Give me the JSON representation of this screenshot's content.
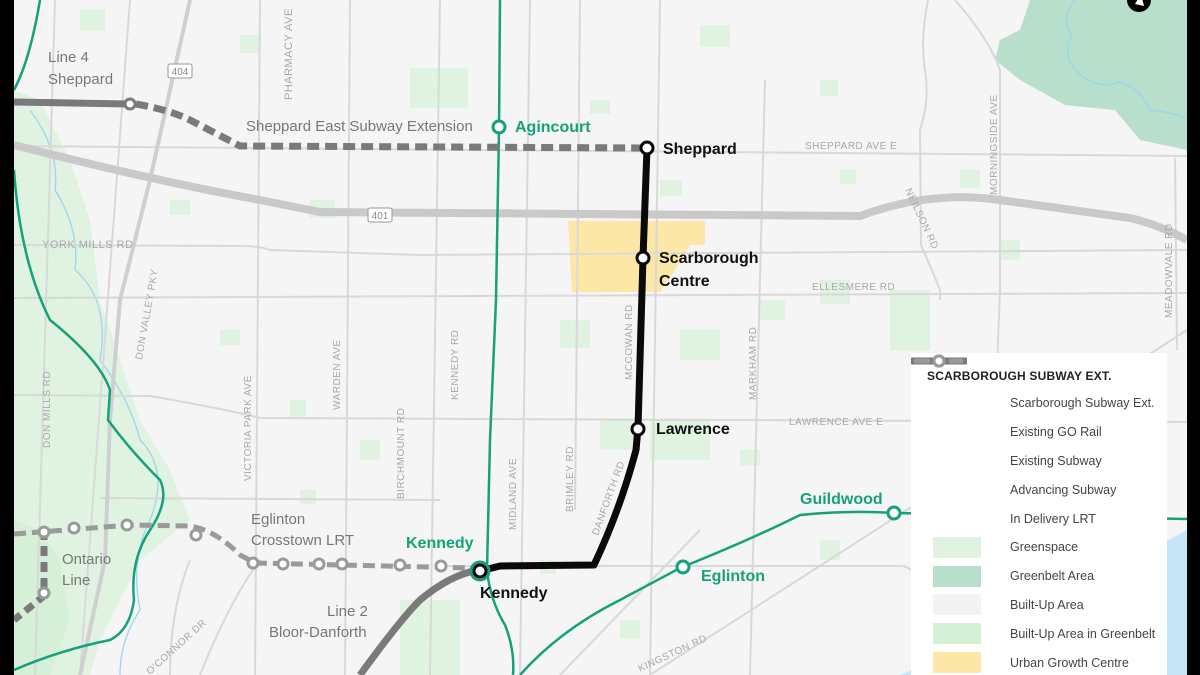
{
  "map": {
    "colors": {
      "background": "#f5f5f5",
      "greenspace": "#dff3e0",
      "greenbelt": "#b7dfcb",
      "builtup_greenbelt": "#d6f0d8",
      "urban_growth_centre": "#fde7a6",
      "water": "#c6e6f8",
      "go_rail": "#16a07c",
      "scarborough_ext": "#0a0a0a",
      "subway": "#7a7a7a",
      "lrt": "#9a9a9a",
      "road": "#d6d6d6",
      "highway": "#c9c9c9"
    },
    "line_labels": {
      "line4": [
        "Line 4",
        "Sheppard"
      ],
      "sheppard_east": "Sheppard East Subway Extension",
      "eglinton_lrt": [
        "Eglinton",
        "Crosstown LRT"
      ],
      "ontario_line": [
        "Ontario",
        "Line"
      ],
      "line2": [
        "Line 2",
        "Bloor-Danforth"
      ]
    },
    "stations": {
      "scarborough": [
        "Sheppard",
        "Scarborough",
        "Centre",
        "Lawrence",
        "Kennedy"
      ],
      "go": [
        "Agincourt",
        "Kennedy",
        "Eglinton",
        "Guildwood"
      ]
    },
    "roads": {
      "pharmacy": "PHARMACY AVE",
      "york_mills": "YORK MILLS RD",
      "sheppard_e": "SHEPPARD AVE E",
      "ellesmere": "ELLESMERE RD",
      "morningside": "MORNINGSIDE AVE",
      "neilson": "NEILSON RD",
      "meadowvale": "MEADOWVALE RD",
      "don_valley": "DON VALLEY PKY",
      "don_mills": "DON MILLS RD",
      "victoria_park": "VICTORIA PARK AVE",
      "warden": "WARDEN AVE",
      "birchmount": "BIRCHMOUNT RD",
      "kennedy_rd": "KENNEDY RD",
      "midland": "MIDLAND AVE",
      "brimley": "BRIMLEY RD",
      "mccowan": "MCCOWAN RD",
      "danforth_rd": "DANFORTH RD",
      "markham": "MARKHAM RD",
      "lawrence_e": "LAWRENCE AVE E",
      "oconnor": "O'CONNOR DR",
      "kingston": "KINGSTON RD",
      "hwy404": "404",
      "hwy401": "401"
    }
  },
  "legend": {
    "title": "SCARBOROUGH SUBWAY EXT.",
    "items": [
      {
        "label": "Scarborough Subway Ext.",
        "type": "line",
        "style": "scarborough"
      },
      {
        "label": "Existing GO Rail",
        "type": "line",
        "style": "go"
      },
      {
        "label": "Existing Subway",
        "type": "line",
        "style": "subway"
      },
      {
        "label": "Advancing Subway",
        "type": "line",
        "style": "advancing"
      },
      {
        "label": "In Delivery LRT",
        "type": "line",
        "style": "lrt"
      },
      {
        "label": "Greenspace",
        "type": "swatch",
        "color": "#dff3e0"
      },
      {
        "label": "Greenbelt Area",
        "type": "swatch",
        "color": "#b7dfcb"
      },
      {
        "label": "Built-Up Area",
        "type": "swatch",
        "color": "#f5f5f5"
      },
      {
        "label": "Built-Up Area in Greenbelt",
        "type": "swatch",
        "color": "#d6f0d8"
      },
      {
        "label": "Urban Growth Centre",
        "type": "swatch",
        "color": "#fde7a6"
      }
    ]
  }
}
